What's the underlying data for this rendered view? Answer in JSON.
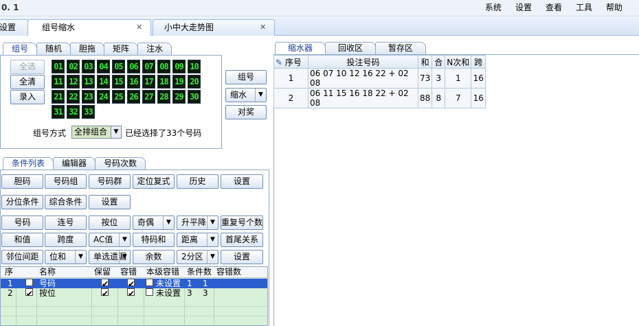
{
  "window": {
    "version": "0. 1"
  },
  "menu": [
    "系统",
    "设置",
    "查看",
    "工具",
    "帮助"
  ],
  "top_tabs": [
    {
      "label": "设置"
    },
    {
      "label": "组号缩水"
    },
    {
      "label": "小中大走势图"
    }
  ],
  "left_tabs": [
    "组号",
    "随机",
    "胆拖",
    "矩阵",
    "注水"
  ],
  "group_buttons": {
    "select_all": "全选",
    "clear_all": "全清",
    "enter": "录入"
  },
  "numbers": [
    "01",
    "02",
    "03",
    "04",
    "05",
    "06",
    "07",
    "08",
    "09",
    "10",
    "11",
    "12",
    "13",
    "14",
    "15",
    "16",
    "17",
    "18",
    "19",
    "20",
    "21",
    "22",
    "23",
    "24",
    "25",
    "26",
    "27",
    "28",
    "29",
    "30",
    "31",
    "32",
    "33"
  ],
  "side_buttons": {
    "group": "组号",
    "shrink": "缩水",
    "check": "对奖"
  },
  "group_mode": {
    "label": "组号方式",
    "value": "全排组合",
    "selected_text": "已经选择了33个号码"
  },
  "cond_tabs": [
    "条件列表",
    "编辑器",
    "号码次数"
  ],
  "cond_row1": [
    "胆码",
    "号码组",
    "号码群",
    "定位复式",
    "历史",
    "设置"
  ],
  "cond_row2": [
    "分位条件",
    "综合条件",
    "设置"
  ],
  "cond_row3": [
    "号码",
    "连号",
    "按位",
    "奇偶",
    "升平降",
    "重复号个数"
  ],
  "cond_row4": [
    "和值",
    "跨度",
    "AC值",
    "特码和",
    "距离",
    "首尾关系"
  ],
  "cond_row5": [
    "邻位间距",
    "位和",
    "单选遗漏",
    "余数",
    "2分区",
    "设置"
  ],
  "cond_grid": {
    "headers": [
      "序",
      "名称",
      "保留",
      "容错",
      "本级容错",
      "条件数",
      "容错数"
    ],
    "rows": [
      {
        "idx": "1",
        "name": "号码",
        "level": "未设置",
        "count": "1",
        "tol": "1"
      },
      {
        "idx": "2",
        "name": "按位",
        "level": "未设置",
        "count": "3",
        "tol": "3"
      }
    ]
  },
  "right_tabs": [
    "缩水器",
    "回收区",
    "暂存区"
  ],
  "result_table": {
    "headers": [
      "序号",
      "投注号码",
      "和",
      "合",
      "N次和",
      "跨"
    ],
    "rows": [
      {
        "idx": "1",
        "nums": "06 07 10 12 16 22 + 02 08",
        "sum": "73",
        "he": "3",
        "nsum": "1",
        "span": "16"
      },
      {
        "idx": "2",
        "nums": "06 11 15 16 18 22 + 02 08",
        "sum": "88",
        "he": "8",
        "nsum": "7",
        "span": "16"
      }
    ]
  }
}
